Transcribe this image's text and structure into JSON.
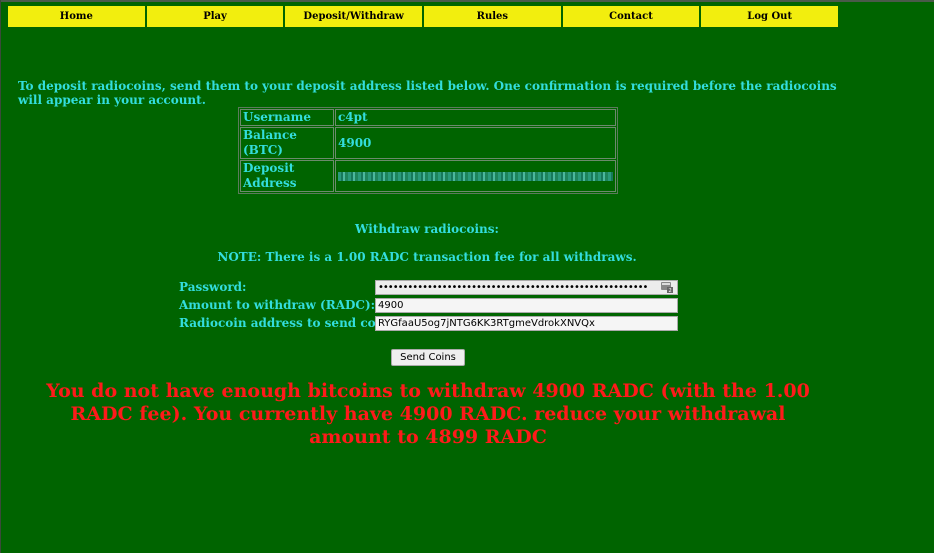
{
  "nav": {
    "items": [
      "Home",
      "Play",
      "Deposit/Withdraw",
      "Rules",
      "Contact",
      "Log Out"
    ]
  },
  "intro": "To deposit radiocoins, send them to your deposit address listed below. One confirmation is required before the radiocoins will appear in your account.",
  "account": {
    "username_label": "Username",
    "username": "c4pt",
    "balance_label": "Balance (BTC)",
    "balance": "4900",
    "deposit_label": "Deposit Address"
  },
  "withdraw": {
    "heading": "Withdraw radiocoins:",
    "note": "NOTE: There is a 1.00 RADC transaction fee for all withdraws.",
    "password_label": "Password:",
    "password_value": "•••••••••••••••••••••••••••••••••••••••••••••••••••••••",
    "amount_label": "Amount to withdraw (RADC):",
    "amount_value": "4900",
    "address_label": "Radiocoin address to send coins to:",
    "address_value": "RYGfaaU5og7jNTG6KK3RTgmeVdrokXNVQx",
    "send_label": "Send Coins"
  },
  "error": "You do not have enough bitcoins to withdraw 4900 RADC (with the 1.00 RADC fee). You currently have 4900 RADC. reduce your withdrawal amount to 4899 RADC",
  "colors": {
    "background": "#006400",
    "nav": "#f2ee0e",
    "text": "#33dddd",
    "error": "#ff1a1a"
  },
  "icons": {
    "password_field": "password-key-icon"
  }
}
